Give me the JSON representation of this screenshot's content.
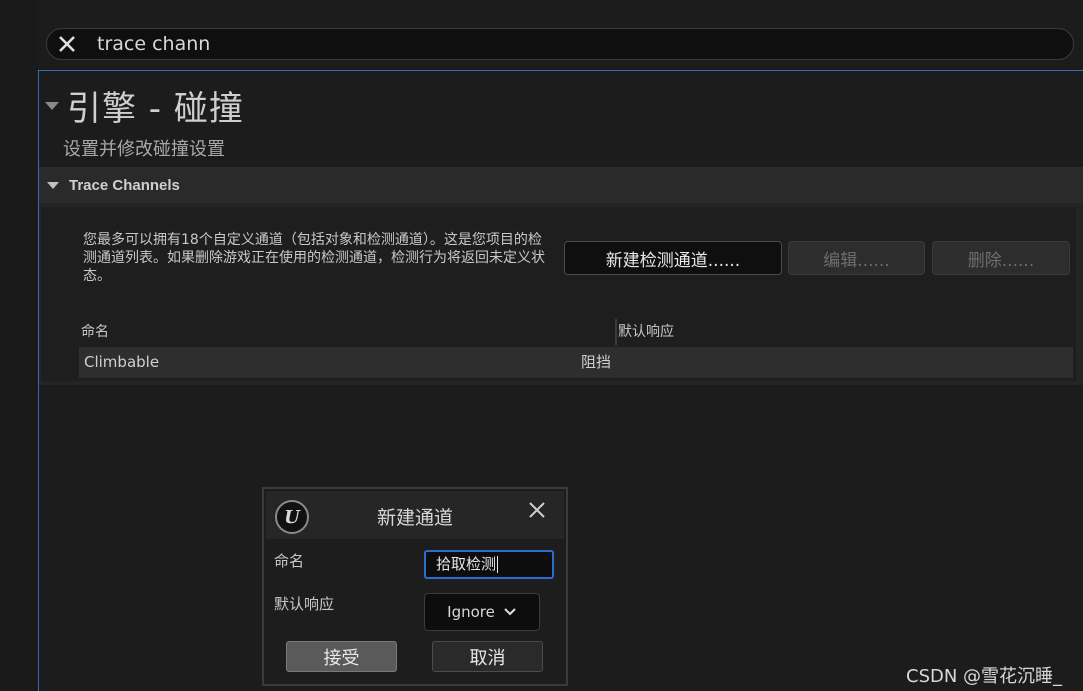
{
  "search": {
    "value": "trace chann"
  },
  "section": {
    "title": "引擎 - 碰撞",
    "description": "设置并修改碰撞设置"
  },
  "category": {
    "title": "Trace Channels",
    "info": "您最多可以拥有18个自定义通道（包括对象和检测通道）。这是您项目的检测通道列表。如果删除游戏正在使用的检测通道，检测行为将返回未定义状态。",
    "buttons": {
      "new_channel": "新建检测通道......",
      "edit": "编辑......",
      "delete": "删除......"
    },
    "table": {
      "headers": {
        "name": "命名",
        "default_response": "默认响应"
      },
      "rows": [
        {
          "name": "Climbable",
          "default_response": "阻挡"
        }
      ]
    }
  },
  "dialog": {
    "logo_text": "U",
    "title": "新建通道",
    "name_label": "命名",
    "name_value": "拾取检测",
    "response_label": "默认响应",
    "response_value": "Ignore",
    "accept_label": "接受",
    "cancel_label": "取消"
  },
  "watermark": "CSDN @雪花沉睡_",
  "colors": {
    "background": "#1c1c1c",
    "panel_border": "#2f6fb5",
    "input_focus": "#2a6dd0",
    "accept_button": "#5a5a5a"
  }
}
